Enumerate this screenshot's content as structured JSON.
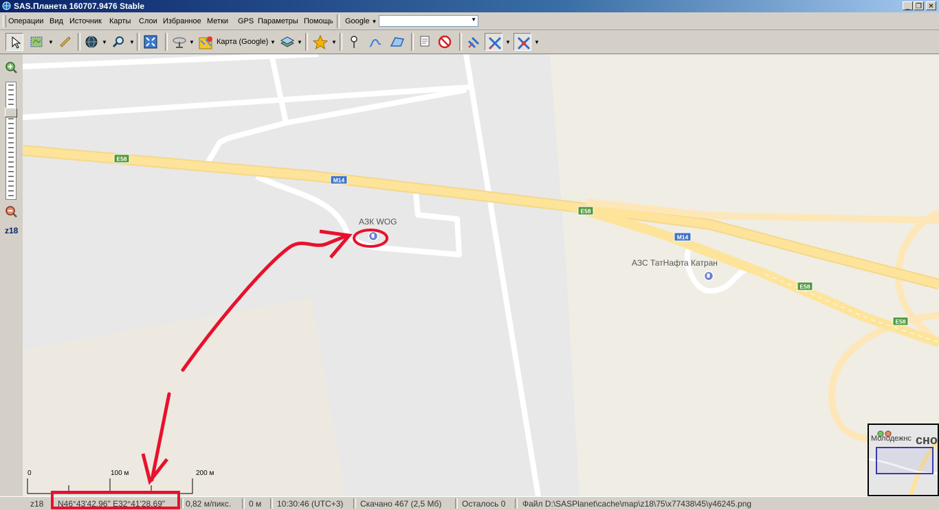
{
  "window": {
    "title": "SAS.Планета 160707.9476 Stable",
    "buttons": [
      "_",
      "❐",
      "✕"
    ]
  },
  "menu": {
    "items": [
      "Операции",
      "Вид",
      "Источник",
      "Карты",
      "Слои",
      "Избранное",
      "Метки",
      "GPS",
      "Параметры",
      "Помощь"
    ],
    "search_provider": "Google",
    "search_value": ""
  },
  "toolbar": {
    "map_source_label": "Карта (Google)"
  },
  "zoom": {
    "level_label": "z18"
  },
  "map": {
    "road_labels": [
      "E58",
      "M14",
      "E58",
      "M14",
      "E58",
      "E58"
    ],
    "pois": [
      "АЗК WOG",
      "АЗС ТатНафта Катран"
    ],
    "scale_labels": [
      "0",
      "100 м",
      "200 м"
    ],
    "colors": {
      "background": "#e8e8e8",
      "highway": "#fde49a",
      "road": "#ffffff",
      "annotation": "#e8112d",
      "road_shield_green": "#4f9a3c",
      "road_shield_blue": "#3f73c4"
    }
  },
  "minimap": {
    "town_partial": "Молодежнс",
    "town2_partial": "сное"
  },
  "status": {
    "zoom": "z18",
    "coordinates": "N46°43'42,96\" E32°41'28,69\"",
    "resolution": "0,82 м/пикс.",
    "distance": "0 м",
    "time": "10:30:46 (UTC+3)",
    "downloaded": "Скачано 467 (2,5 Мб)",
    "remaining": "Осталось 0",
    "file": "Файл D:\\SASPlanet\\cache\\map\\z18\\75\\x77438\\45\\y46245.png"
  }
}
